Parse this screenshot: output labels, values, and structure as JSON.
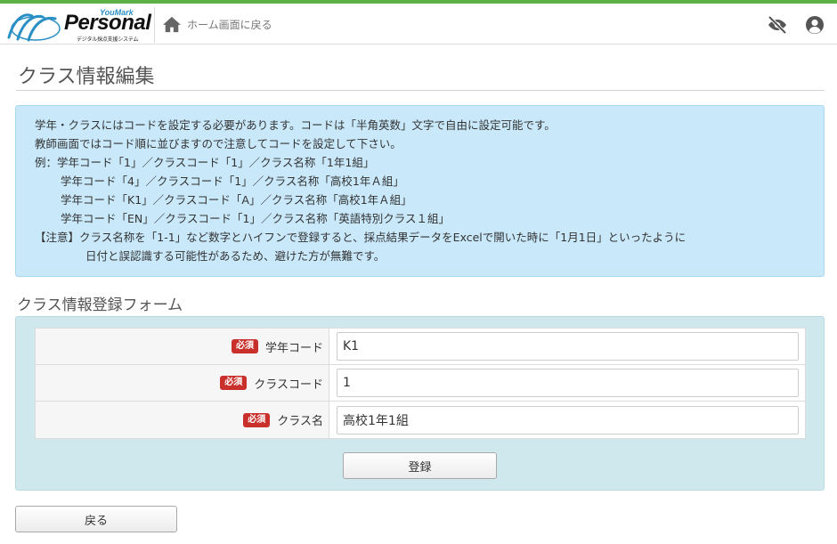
{
  "colors": {
    "accent_bar": "#5db045",
    "notice_bg": "#c9e9fb",
    "form_bg": "#cfe8ee",
    "required": "#c9302c",
    "logo_blue": "#2a8fc5"
  },
  "header": {
    "logo_sub": "YouMark",
    "logo_main": "Personal",
    "logo_tag": "デジタル採点支援システム",
    "home_label": "ホーム画面に戻る",
    "icons": [
      "home-icon",
      "eye-slash-icon",
      "user-icon"
    ]
  },
  "page": {
    "title": "クラス情報編集"
  },
  "notice": {
    "lines": [
      "学年・クラスにはコードを設定する必要があります。コードは「半角英数」文字で自由に設定可能です。",
      "教師画面ではコード順に並びますので注意してコードを設定して下さい。",
      "例：学年コード「1」／クラスコード「1」／クラス名称「1年1組」",
      "学年コード「4」／クラスコード「1」／クラス名称「高校1年Ａ組」",
      "学年コード「K1」／クラスコード「A」／クラス名称「高校1年Ａ組」",
      "学年コード「EN」／クラスコード「1」／クラス名称「英語特別クラス１組」",
      "【注意】クラス名称を「1-1」など数字とハイフンで登録すると、採点結果データをExcelで開いた時に「1月1日」といったように",
      "日付と誤認識する可能性があるため、避けた方が無難です。"
    ]
  },
  "form": {
    "title": "クラス情報登録フォーム",
    "required_badge": "必須",
    "fields": [
      {
        "label": "学年コード",
        "value": "K1"
      },
      {
        "label": "クラスコード",
        "value": "1"
      },
      {
        "label": "クラス名",
        "value": "高校1年1組"
      }
    ],
    "submit_label": "登録"
  },
  "footer": {
    "back_label": "戻る"
  }
}
